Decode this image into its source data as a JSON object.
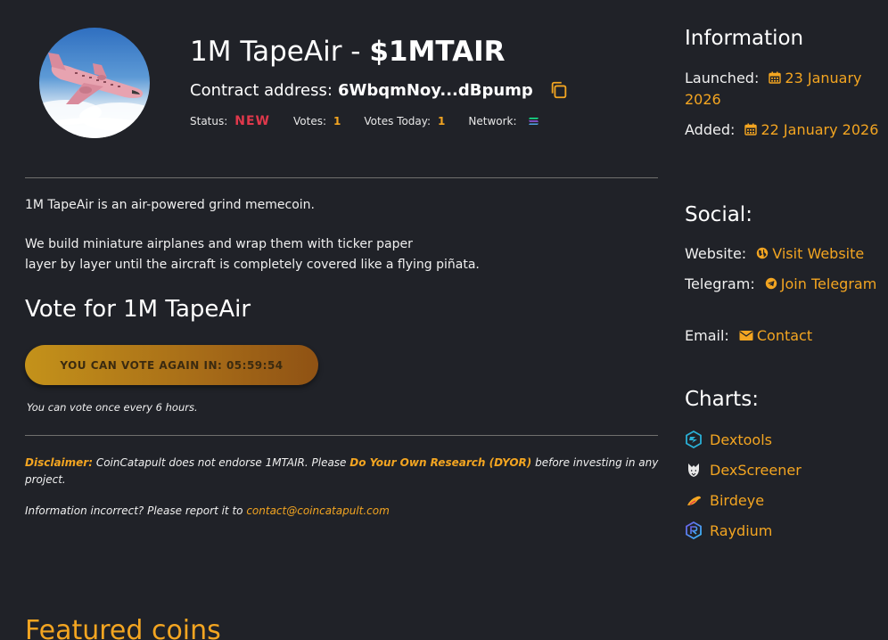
{
  "coin": {
    "name": "1M TapeAir",
    "title_separator": " - ",
    "ticker": "$1MTAIR",
    "contract_label": "Contract address:",
    "contract_address": "6WbqmNoy...dBpump"
  },
  "status": {
    "status_label": "Status:",
    "status_value": "NEW",
    "votes_label": "Votes:",
    "votes_value": "1",
    "votes_today_label": "Votes Today:",
    "votes_today_value": "1",
    "network_label": "Network:",
    "network_icon": "solana-icon"
  },
  "description": {
    "line1": "1M TapeAir is an air-powered grind memecoin.",
    "line2": "We build miniature airplanes and wrap them with ticker paper",
    "line3": "layer by layer until the aircraft is completely covered like a flying piñata."
  },
  "vote": {
    "heading": "Vote for 1M TapeAir",
    "button_label": "YOU CAN VOTE AGAIN IN: 05:59:54",
    "note": "You can vote once every 6 hours."
  },
  "disclaimer": {
    "label": "Disclaimer:",
    "text1": " CoinCatapult does not endorse 1MTAIR. Please ",
    "dyor": "Do Your Own Research (DYOR)",
    "text2": " before investing in any project.",
    "report_text": "Information incorrect? Please report it to ",
    "report_email": "contact@coincatapult.com"
  },
  "featured": {
    "heading": "Featured coins"
  },
  "sidebar": {
    "info_heading": "Information",
    "launched_label": "Launched:",
    "launched_value": "23 January 2026",
    "added_label": "Added:",
    "added_value": "22 January 2026",
    "social_heading": "Social:",
    "website_label": "Website:",
    "website_value": "Visit Website",
    "telegram_label": "Telegram:",
    "telegram_value": "Join Telegram",
    "email_label": "Email:",
    "email_value": "Contact",
    "charts_heading": "Charts:",
    "charts": [
      {
        "label": "Dextools",
        "icon": "dextools-icon"
      },
      {
        "label": "DexScreener",
        "icon": "dexscreener-icon"
      },
      {
        "label": "Birdeye",
        "icon": "birdeye-icon"
      },
      {
        "label": "Raydium",
        "icon": "raydium-icon"
      }
    ]
  },
  "colors": {
    "background": "#202228",
    "accent": "#f3a521",
    "new_badge": "#e0384b"
  }
}
